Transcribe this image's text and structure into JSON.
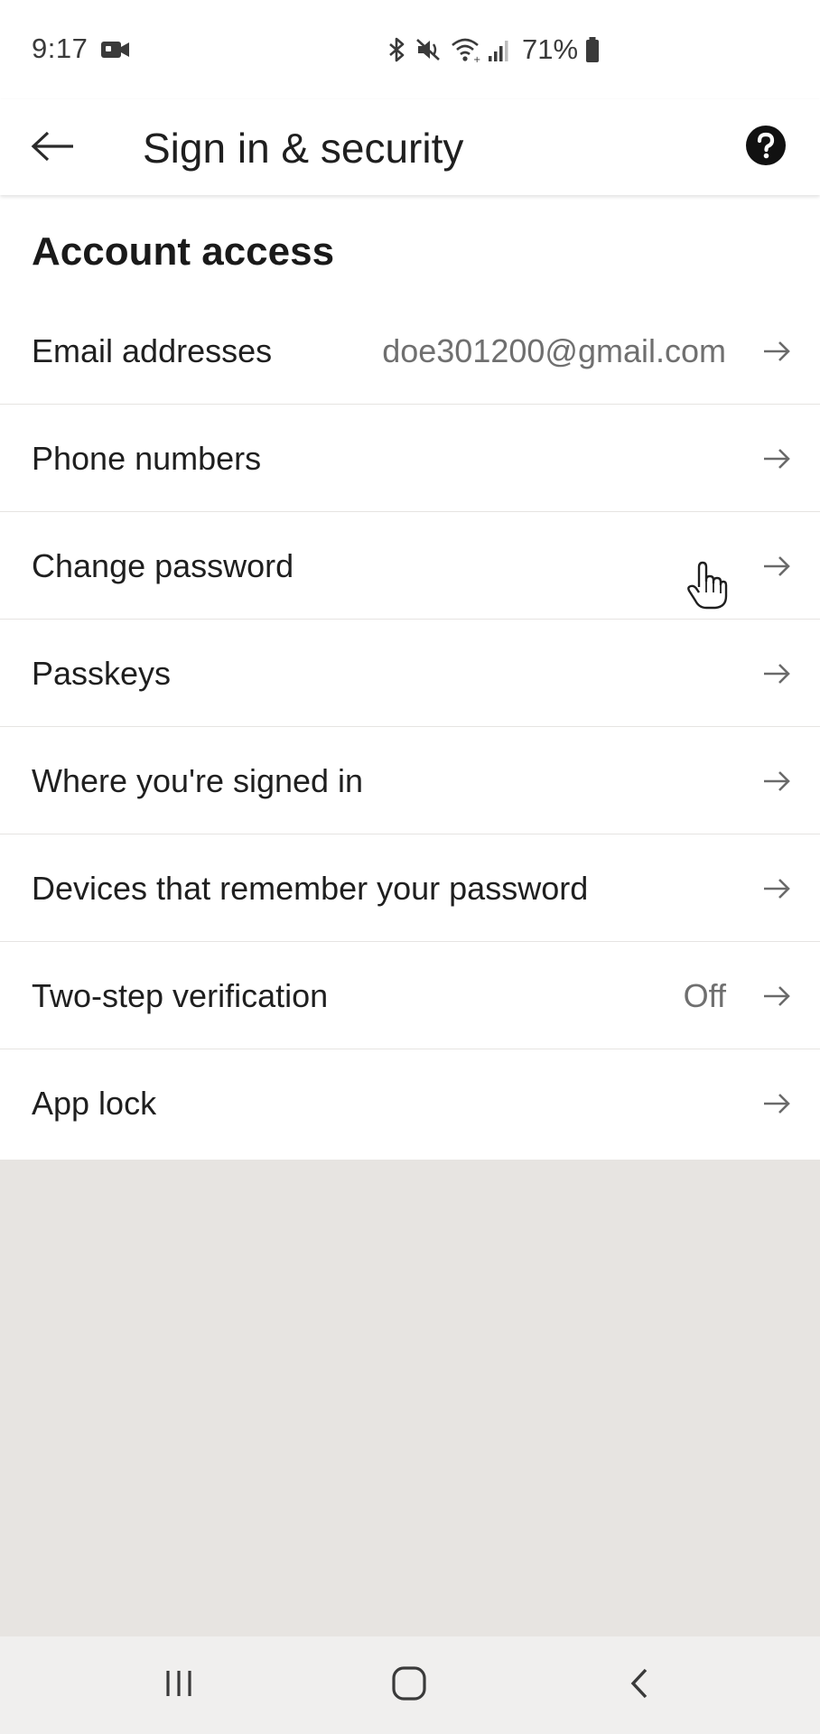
{
  "status_bar": {
    "time": "9:17",
    "battery_percent": "71%",
    "icons": [
      "video-camera-icon",
      "bluetooth-icon",
      "mute-icon",
      "wifi-icon",
      "signal-icon",
      "battery-icon"
    ]
  },
  "app_bar": {
    "title": "Sign in & security",
    "back_icon": "back-arrow-icon",
    "help_icon": "help-circle-icon"
  },
  "section": {
    "title": "Account access"
  },
  "rows": [
    {
      "label": "Email addresses",
      "value": "doe301200@gmail.com"
    },
    {
      "label": "Phone numbers",
      "value": ""
    },
    {
      "label": "Change password",
      "value": ""
    },
    {
      "label": "Passkeys",
      "value": ""
    },
    {
      "label": "Where you're signed in",
      "value": ""
    },
    {
      "label": "Devices that remember your password",
      "value": ""
    },
    {
      "label": "Two-step verification",
      "value": "Off"
    },
    {
      "label": "App lock",
      "value": ""
    }
  ],
  "nav_bar": {
    "icons": [
      "recent-apps-icon",
      "home-icon",
      "back-icon"
    ]
  },
  "colors": {
    "surface": "#ffffff",
    "background": "#e7e4e1",
    "text_primary": "#1f1f1f",
    "text_secondary": "#6f6f6f",
    "divider": "#e6e4e2",
    "nav_bar": "#f0efee"
  }
}
